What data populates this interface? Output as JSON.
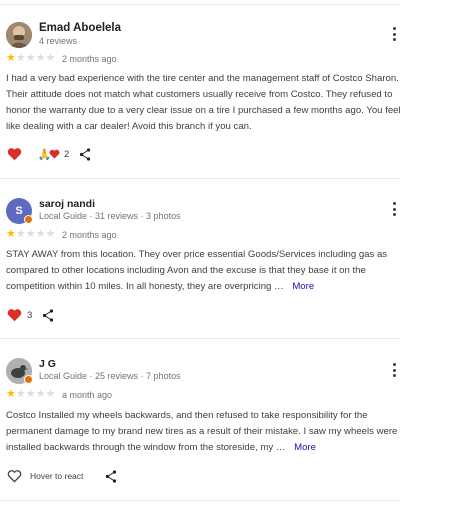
{
  "reviews": [
    {
      "author": "Emad Aboelela",
      "meta": "4 reviews",
      "rating": 1,
      "date": "2 months ago",
      "text": "I had a very bad experience with the tire center and the management staff of Costco Sharon. Their attitude does not match what customers usually receive from Costco. They refused to honor the warranty due to a very clear issue on a tire I purchased a few months ago. You feel like dealing with a car dealer! Avoid this branch if you can.",
      "reactions_count": "2",
      "more_label": ""
    },
    {
      "author": "saroj nandi",
      "meta": "Local Guide · 31 reviews · 3 photos",
      "avatar_letter": "S",
      "rating": 1,
      "date": "2 months ago",
      "text": "STAY AWAY from this location. They over price essential Goods/Services including gas as compared to other locations including Avon and the excuse is that they base it on the competition within 10 miles. In all honesty, they are overpricing …",
      "reactions_count": "3",
      "more_label": "More"
    },
    {
      "author": "J G",
      "meta": "Local Guide · 25 reviews · 7 photos",
      "rating": 1,
      "date": "a month ago",
      "text": "Costco Installed my wheels backwards, and then refused to take responsibility for the permanent damage to my brand new tires as a result of their mistake. I saw my wheels were installed backwards through the window from the storeside, my …",
      "hover_label": "Hover to react",
      "more_label": "More"
    }
  ],
  "colors": {
    "star_filled": "#fbbc04",
    "star_empty": "#dadce0",
    "heart": "#d93025",
    "link": "#1a0dab",
    "local_guide_badge": "#e37400"
  }
}
